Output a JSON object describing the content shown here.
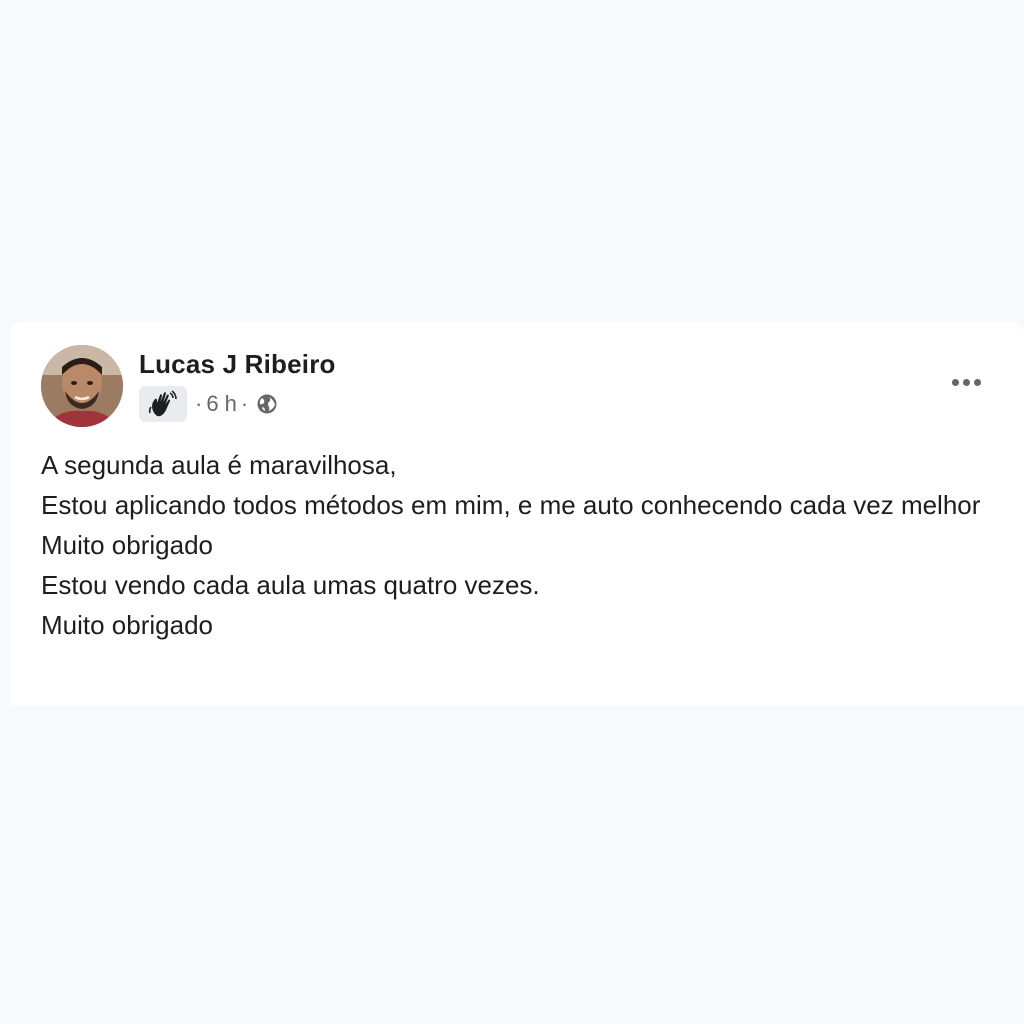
{
  "post": {
    "author_name": "Lucas J Ribeiro",
    "time": "6 h",
    "separator": "·",
    "badge_icon": "hand-wave-icon",
    "privacy_icon": "globe-icon",
    "more_icon": "more-options-icon",
    "lines": [
      "A segunda aula é maravilhosa,",
      "Estou aplicando todos métodos em mim, e me auto conhecendo cada vez melhor",
      "Muito obrigado",
      "Estou vendo cada aula umas quatro vezes.",
      "Muito obrigado"
    ]
  },
  "colors": {
    "background": "#f7f9fc",
    "card": "#ffffff",
    "text": "#1c1e21",
    "meta": "#65676b"
  }
}
